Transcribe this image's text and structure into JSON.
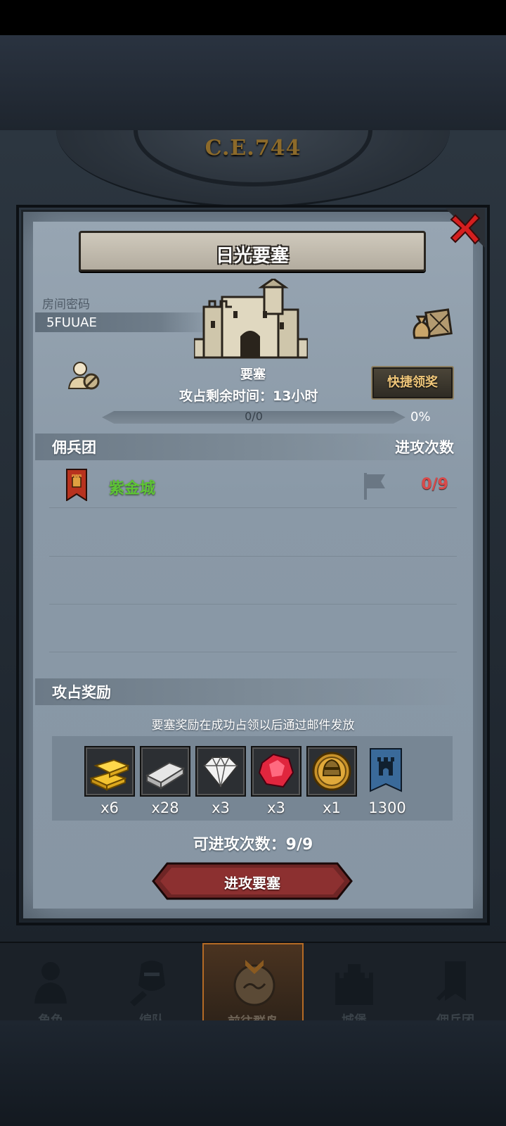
{
  "header": {
    "year": "C.E.744"
  },
  "dialog": {
    "title": "日光要塞",
    "room_label": "房间密码",
    "room_code": "5FUUAE",
    "fortress_type": "要塞",
    "quick_claim_label": "快捷领奖",
    "time_remaining": "攻占剩余时间：13小时",
    "progress": {
      "text": "0/0",
      "percent_label": "0%",
      "value": 0
    }
  },
  "mercenary_section": {
    "title": "佣兵团",
    "attack_count_header": "进攻次数",
    "rows": [
      {
        "name": "紫金城",
        "count": "0/9"
      }
    ]
  },
  "reward_section": {
    "title": "攻占奖励",
    "note": "要塞奖励在成功占领以后通过邮件发放",
    "items": [
      {
        "icon": "gold-bar-icon",
        "qty": "x6"
      },
      {
        "icon": "iron-ingot-icon",
        "qty": "x28"
      },
      {
        "icon": "diamond-icon",
        "qty": "x3"
      },
      {
        "icon": "ruby-icon",
        "qty": "x3"
      },
      {
        "icon": "knight-medal-icon",
        "qty": "x1"
      },
      {
        "icon": "guild-banner-icon",
        "qty": "1300"
      }
    ]
  },
  "attack": {
    "remaining": "可进攻次数：9/9",
    "button_label": "进攻要塞"
  },
  "nav": {
    "items": [
      {
        "label": "角色",
        "active": false
      },
      {
        "label": "编队",
        "active": false
      },
      {
        "label": "前往群岛",
        "active": true
      },
      {
        "label": "城堡",
        "active": false
      },
      {
        "label": "佣兵团",
        "active": false
      }
    ]
  },
  "colors": {
    "merc_name": "#5ec436",
    "count_red": "#d84a4a",
    "quick_btn_text": "#f0c77a",
    "attack_btn": "#7a2a2a"
  }
}
